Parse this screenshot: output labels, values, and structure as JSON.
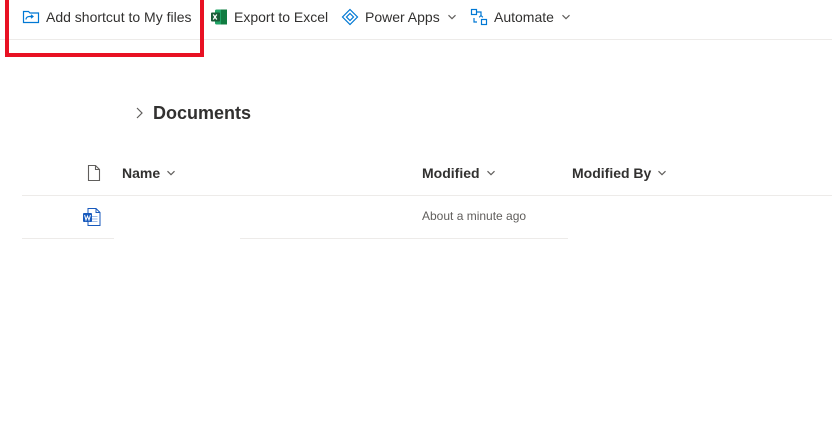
{
  "toolbar": {
    "add_shortcut": "Add shortcut to My files",
    "export_excel": "Export to Excel",
    "power_apps": "Power Apps",
    "automate": "Automate"
  },
  "breadcrumb": {
    "current": "Documents"
  },
  "columns": {
    "name": "Name",
    "modified": "Modified",
    "modified_by": "Modified By"
  },
  "rows": [
    {
      "name": "",
      "modified": "About a minute ago",
      "modified_by": ""
    }
  ],
  "colors": {
    "accent": "#0078d4",
    "excel": "#107c41",
    "word": "#185abd",
    "highlight": "#e81123"
  }
}
